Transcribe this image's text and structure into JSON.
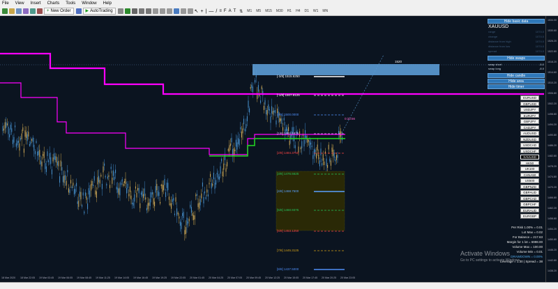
{
  "menu": [
    "File",
    "View",
    "Insert",
    "Charts",
    "Tools",
    "Window",
    "Help"
  ],
  "toolbar": {
    "new_order": "New Order",
    "autotrading": "AutoTrading",
    "timeframes": [
      "M1",
      "M5",
      "M15",
      "M30",
      "H1",
      "H4",
      "D1",
      "W1",
      "MN"
    ]
  },
  "panel": {
    "hide_basic": "Hide basic data",
    "symbol": "XAUUSD",
    "labels": [
      "range",
      "change",
      "distance from high",
      "distance from low",
      "spread"
    ],
    "values": [
      "1074.0",
      "1074.0",
      "1074.0",
      "1074.0",
      "1074.0"
    ],
    "hide_swaps": "Hide swaps",
    "swap_labels": [
      "swap short",
      "swap long"
    ],
    "swap_values": [
      "-5.0",
      "-8.0"
    ],
    "hide_candle": "Hide candle",
    "hide_area": "Hide area",
    "hide_timer": "Hide timer"
  },
  "symbols": [
    "EURUSD",
    "GBPUSD",
    "USDJPY",
    "EURJPY",
    "GBPJPY",
    "CADJPY",
    "AUDUSD",
    "NZDUSD",
    "USDCAD",
    "USDCHF",
    "XAUUSD",
    "HK50",
    "UK100",
    "CHNA50",
    "US500",
    "GBPNZD",
    "GBPAUD",
    "GBPCAD",
    "GBPCHF",
    "EURAUD",
    "EURGBP"
  ],
  "active_symbol": "XAUUSD",
  "stats": [
    "Per Risk 1.00% = 0.01",
    "Lot Max = 0.02",
    "For Balance = 217.63",
    "Margin for 1 lot = 6998.00",
    "Volume Max = 100.00",
    "Volume Min = 0.01",
    "DRAWDOWN = 0.00%",
    "Leverage = 1:30 | Spread = 38"
  ],
  "levels": [
    {
      "label": "[-3/8]",
      "price": "1515.6250",
      "color": "#ffffff"
    },
    {
      "label": "[-1/8]",
      "price": "1507.8125",
      "color": "#ffffff"
    },
    {
      "label": "[0/8]",
      "price": "1500.0000",
      "color": "#4f8ef7"
    },
    {
      "label": "[1/8]",
      "price": "1492.1875",
      "color": "#e0b0ff"
    },
    {
      "label": "[2/8]",
      "price": "1484.3750",
      "color": "#ff4444"
    },
    {
      "label": "[3/8]",
      "price": "1476.5625",
      "color": "#22c55e"
    },
    {
      "label": "[4/8]",
      "price": "1468.7500",
      "color": "#5aa0ff"
    },
    {
      "label": "[5/8]",
      "price": "1460.9375",
      "color": "#22c55e"
    },
    {
      "label": "[6/8]",
      "price": "1453.1250",
      "color": "#ff4444"
    },
    {
      "label": "[7/8]",
      "price": "1445.3125",
      "color": "#d4a017"
    },
    {
      "label": "[8/8]",
      "price": "1437.5000",
      "color": "#4f8ef7"
    }
  ],
  "timer": "0:33:56",
  "box_label": "1520",
  "price_axis": [
    "1534.00",
    "1530.60",
    "1526.20",
    "1522.80",
    "1518.20",
    "1514.60",
    "1510.20",
    "1506.80",
    "1502.20",
    "1498.80",
    "1494.20",
    "1490.80",
    "1486.20",
    "1482.80",
    "1478.20",
    "1474.80",
    "1470.20",
    "1466.80",
    "1462.20",
    "1458.80",
    "1454.20",
    "1450.80",
    "1446.20",
    "1442.80",
    "1438.20"
  ],
  "time_axis": [
    "18 Mar 2020",
    "18 Mar 22:05",
    "19 Mar 03:45",
    "19 Mar 06:05",
    "19 Mar 08:45",
    "19 Mar 11:25",
    "19 Mar 14:05",
    "19 Mar 16:45",
    "19 Mar 19:25",
    "19 Mar 22:05",
    "20 Mar 01:45",
    "20 Mar 04:25",
    "20 Mar 07:05",
    "20 Mar 09:45",
    "20 Mar 12:25",
    "20 Mar 15:05",
    "20 Mar 17:45",
    "20 Mar 20:25",
    "20 Mar 23:05"
  ],
  "watermark": {
    "title": "Activate Windows",
    "sub": "Go to PC settings to activate Windows."
  },
  "colors": {
    "magenta": "#ff00ff",
    "green": "#22dd22",
    "box": "#5b9bd5",
    "candle": "#7aa5c8"
  }
}
